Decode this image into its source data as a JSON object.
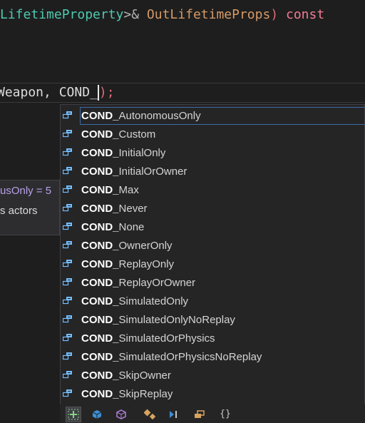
{
  "editor": {
    "line1": {
      "type": "LifetimeProperty",
      "op": ">&",
      "param": "OutLifetimeProps",
      "close": ")",
      "keyword": "const"
    },
    "line2": {
      "prefix": "Weapon",
      "comma": ",",
      "typed": "COND_",
      "close": ");"
    }
  },
  "tooltip": {
    "line1": "usOnly = 5",
    "line2": "s actors"
  },
  "autocomplete": {
    "prefix": "COND_",
    "items": [
      {
        "prefix": "COND_",
        "rest": "AutonomousOnly"
      },
      {
        "prefix": "COND_",
        "rest": "Custom"
      },
      {
        "prefix": "COND_",
        "rest": "InitialOnly"
      },
      {
        "prefix": "COND_",
        "rest": "InitialOrOwner"
      },
      {
        "prefix": "COND_",
        "rest": "Max"
      },
      {
        "prefix": "COND_",
        "rest": "Never"
      },
      {
        "prefix": "COND_",
        "rest": "None"
      },
      {
        "prefix": "COND_",
        "rest": "OwnerOnly"
      },
      {
        "prefix": "COND_",
        "rest": "ReplayOnly"
      },
      {
        "prefix": "COND_",
        "rest": "ReplayOrOwner"
      },
      {
        "prefix": "COND_",
        "rest": "SimulatedOnly"
      },
      {
        "prefix": "COND_",
        "rest": "SimulatedOnlyNoReplay"
      },
      {
        "prefix": "COND_",
        "rest": "SimulatedOrPhysics"
      },
      {
        "prefix": "COND_",
        "rest": "SimulatedOrPhysicsNoReplay"
      },
      {
        "prefix": "COND_",
        "rest": "SkipOwner"
      },
      {
        "prefix": "COND_",
        "rest": "SkipReplay"
      }
    ],
    "item_icon": "enum-member-icon"
  },
  "filters": {
    "icons": [
      "expand-plus-icon",
      "cube-icon",
      "namespace-icon",
      "class-icon",
      "enum-icon",
      "enum-member-icon",
      "braces-icon"
    ],
    "braces_glyph": "{}"
  },
  "colors": {
    "background": "#1e1e1e",
    "popup": "#252526",
    "selection_border": "#3e6aa8",
    "icon_blue": "#75beff"
  }
}
